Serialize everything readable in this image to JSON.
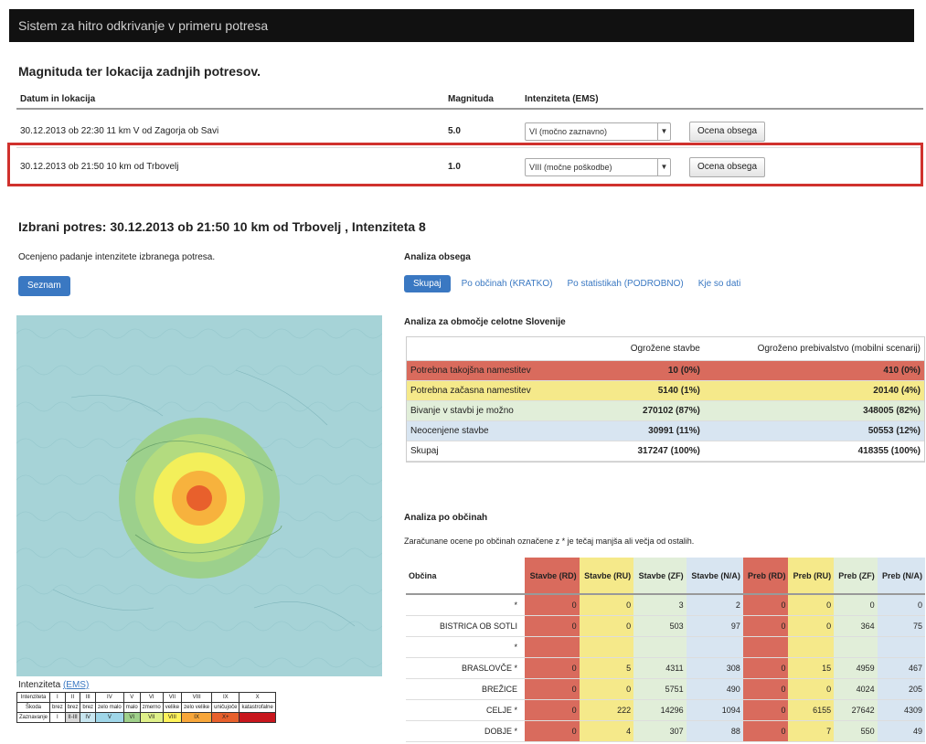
{
  "app": {
    "title": "Sistem za hitro odkrivanje v primeru potresa"
  },
  "recent": {
    "title": "Magnituda ter lokacija zadnjih potresov.",
    "headers": {
      "loc": "Datum in lokacija",
      "mag": "Magnituda",
      "int": "Intenziteta (EMS)"
    },
    "rows": [
      {
        "loc": "30.12.2013 ob 22:30 11 km V od Zagorja ob Savi",
        "mag": "5.0",
        "int": "VI (močno zaznavno)",
        "btn": "Ocena obsega"
      },
      {
        "loc": "30.12.2013 ob 21:50 10 km od Trbovelj",
        "mag": "1.0",
        "int": "VIII (močne poškodbe)",
        "btn": "Ocena obsega"
      }
    ]
  },
  "selected": {
    "title": "Izbrani potres: 30.12.2013 ob 21:50 10 km od Trbovelj , Intenziteta 8"
  },
  "left": {
    "label": "Ocenjeno padanje intenzitete izbranega potresa.",
    "button": "Seznam"
  },
  "legend": {
    "title": "Intenziteta",
    "link": "(EMS)",
    "rows": [
      [
        "Intenziteta",
        "I",
        "II",
        "III",
        "IV",
        "V",
        "VI",
        "VII",
        "VIII",
        "IX",
        "X"
      ],
      [
        "Škoda",
        "brez",
        "brez",
        "brez",
        "zelo malo",
        "malo",
        "zmerno",
        "velike",
        "zelo velike",
        "uničujoče",
        "katastrofalne"
      ],
      [
        "Zaznavanje",
        "I",
        "II-III",
        "IV",
        "V",
        "VI",
        "VII",
        "VIII",
        "IX",
        "X+",
        ""
      ]
    ],
    "colors": [
      "#ffffff",
      "#d9d9d9",
      "#c8e6f0",
      "#9fd6e8",
      "#9fd08a",
      "#dff089",
      "#fff35a",
      "#f7a63a",
      "#e8602c",
      "#c8161d"
    ]
  },
  "analysis": {
    "title": "Analiza obsega",
    "pills": [
      "Skupaj",
      "Po občinah (KRATKO)",
      "Po statistikah (PODROBNO)",
      "Kje so dati"
    ],
    "area_title": "Analiza za območje celotne Slovenije",
    "table_headers": [
      "",
      "Ogrožene stavbe",
      "Ogroženo prebivalstvo (mobilni scenarij)"
    ],
    "rows": [
      {
        "label": "Potrebna takojšna namestitev",
        "stavbe": "10 (0%)",
        "preb": "410 (0%)",
        "color": "#d96b5d"
      },
      {
        "label": "Potrebna začasna namestitev",
        "stavbe": "5140 (1%)",
        "preb": "20140 (4%)",
        "color": "#f5e98a"
      },
      {
        "label": "Bivanje v stavbi je možno",
        "stavbe": "270102 (87%)",
        "preb": "348005 (82%)",
        "color": "#e1eed9"
      },
      {
        "label": "Neocenjene stavbe",
        "stavbe": "30991 (11%)",
        "preb": "50553 (12%)",
        "color": "#d8e5f1"
      },
      {
        "label": "Skupaj",
        "stavbe": "317247 (100%)",
        "preb": "418355 (100%)",
        "color": "#ffffff"
      }
    ],
    "mun_title": "Analiza po občinah",
    "mun_note": "Zaračunane ocene po občinah označene z * je tečaj manjša ali večja od ostalih.",
    "mun_headers": [
      "Občina",
      "Stavbe (RD)",
      "Stavbe (RU)",
      "Stavbe (ZF)",
      "Stavbe (N/A)",
      "Preb (RD)",
      "Preb (RU)",
      "Preb (ZF)",
      "Preb (N/A)"
    ],
    "mun_rows": [
      [
        "*",
        "0",
        "0",
        "3",
        "2",
        "0",
        "0",
        "0",
        "0"
      ],
      [
        "BISTRICA OB SOTLI",
        "0",
        "0",
        "503",
        "97",
        "0",
        "0",
        "364",
        "75"
      ],
      [
        "*",
        "",
        "",
        "",
        "",
        "",
        "",
        "",
        ""
      ],
      [
        "BRASLOVČE *",
        "0",
        "5",
        "4311",
        "308",
        "0",
        "15",
        "4959",
        "467"
      ],
      [
        "BREŽICE",
        "0",
        "0",
        "5751",
        "490",
        "0",
        "0",
        "4024",
        "205"
      ],
      [
        "CELJE *",
        "0",
        "222",
        "14296",
        "1094",
        "0",
        "6155",
        "27642",
        "4309"
      ],
      [
        "DOBJE *",
        "0",
        "4",
        "307",
        "88",
        "0",
        "7",
        "550",
        "49"
      ]
    ],
    "mun_colors": [
      "#d96b5d",
      "#f5e98a",
      "#e1eed9",
      "#d8e5f1",
      "#d96b5d",
      "#f5e98a",
      "#e1eed9",
      "#d8e5f1"
    ]
  }
}
